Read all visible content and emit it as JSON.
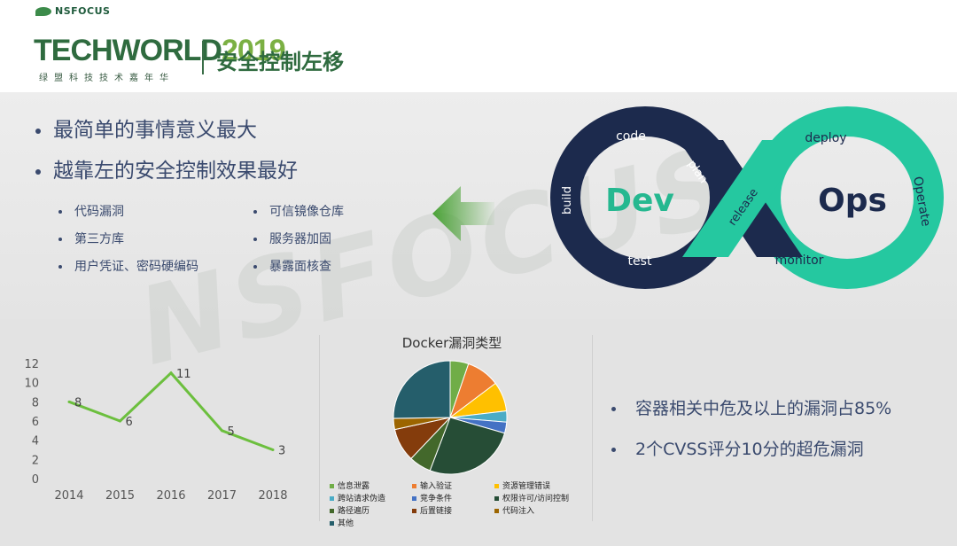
{
  "header": {
    "brand_small": "NSFOCUS",
    "brand_tech": "TECHWORLD",
    "brand_year": "2019",
    "brand_sub": "绿盟科技技术嘉年华",
    "title": "安全控制左移"
  },
  "bullets": [
    "最简单的事情意义最大",
    "越靠左的安全控制效果最好"
  ],
  "sub_bullets_left": [
    "代码漏洞",
    "第三方库",
    "用户凭证、密码硬编码"
  ],
  "sub_bullets_right": [
    "可信镜像仓库",
    "服务器加固",
    "暴露面核查"
  ],
  "devops": {
    "dev": "Dev",
    "ops": "Ops",
    "labels": [
      "code",
      "plan",
      "build",
      "test",
      "release",
      "deploy",
      "Operate",
      "monitor"
    ]
  },
  "watermark": "NSFOCUS",
  "chart_data": [
    {
      "type": "line",
      "x": [
        "2014",
        "2015",
        "2016",
        "2017",
        "2018"
      ],
      "y": [
        8,
        6,
        11,
        5,
        3
      ],
      "yticks": [
        "0",
        "2",
        "4",
        "6",
        "8",
        "10",
        "12"
      ],
      "ylim": [
        0,
        12
      ],
      "grid": false,
      "color": "#6cbf3e"
    },
    {
      "type": "pie",
      "title": "Docker漏洞类型",
      "legend_placement": "bottom",
      "slices": [
        {
          "label": "信息泄露",
          "value": 5,
          "color": "#70ad47"
        },
        {
          "label": "输入验证",
          "value": 9,
          "color": "#ed7d31"
        },
        {
          "label": "资源管理错误",
          "value": 8,
          "color": "#ffc000"
        },
        {
          "label": "跨站请求伪造",
          "value": 3,
          "color": "#4bacc6"
        },
        {
          "label": "竞争条件",
          "value": 3,
          "color": "#4472c4"
        },
        {
          "label": "权限许可/访问控制",
          "value": 25,
          "color": "#264d36"
        },
        {
          "label": "路径遍历",
          "value": 6,
          "color": "#43682b"
        },
        {
          "label": "后置链接",
          "value": 9,
          "color": "#843c0c"
        },
        {
          "label": "代码注入",
          "value": 3,
          "color": "#9c6500"
        },
        {
          "label": "其他",
          "value": 24,
          "color": "#255e6b"
        }
      ]
    }
  ],
  "right_bullets": [
    "容器相关中危及以上的漏洞占85%",
    "2个CVSS评分10分的超危漏洞"
  ]
}
